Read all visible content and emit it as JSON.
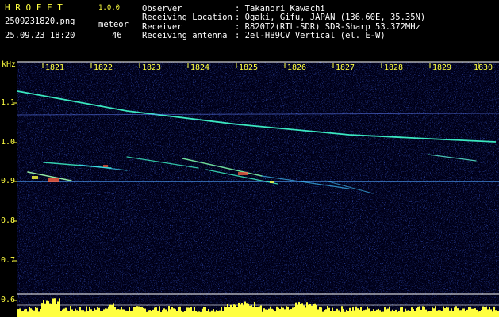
{
  "header": {
    "app_title": "H R O F F T",
    "version": "1.0.0",
    "filename": "2509231820.png",
    "datetime": "25.09.23 18:20",
    "meteor_label": "meteor",
    "meteor_count": "46",
    "observer_label": "Observer",
    "observer_value": ": Takanori Kawachi",
    "location_label": "Receiving Location",
    "location_value": ": Ogaki, Gifu, JAPAN (136.60E, 35.35N)",
    "receiver_label": "Receiver",
    "receiver_value": ": R820T2(RTL-SDR) SDR-Sharp 53.372MHz",
    "antenna_label": "Receiving antenna",
    "antenna_value": ": 2el-HB9CV Vertical (el. E-W)"
  },
  "axes": {
    "y_unit": "kHz",
    "x_ticks": [
      "1821",
      "1822",
      "1823",
      "1824",
      "1825",
      "1826",
      "1827",
      "1828",
      "1829",
      "1830"
    ],
    "y_ticks": [
      "1.1",
      "1.0",
      "0.9",
      "0.8",
      "0.7",
      "0.6"
    ]
  },
  "colors": {
    "yellow": "#ffff40",
    "white": "#ffffff",
    "noise_blue": "#1a2fa0",
    "trace_cyan": "#40ffd0",
    "grid_white": "#ffffff"
  }
}
